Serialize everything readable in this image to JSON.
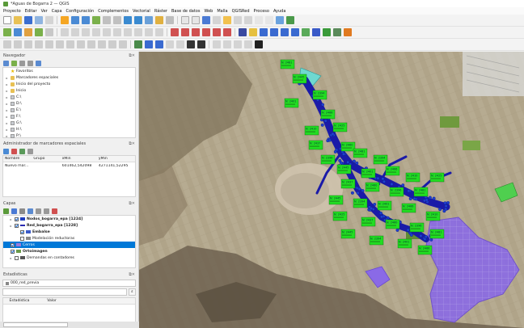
{
  "window": {
    "title": "*Aguas de Bogarra 2 — QGIS"
  },
  "menu": [
    "Proyecto",
    "Editar",
    "Ver",
    "Capa",
    "Configuración",
    "Complementos",
    "Vectorial",
    "Ráster",
    "Base de datos",
    "Web",
    "Malla",
    "QGISRed",
    "Proceso",
    "Ayuda"
  ],
  "browser": {
    "title": "Navegador",
    "items": [
      {
        "label": "Favoritos",
        "icon": "star-icon"
      },
      {
        "label": "Marcadores espaciales",
        "icon": "bookmark-icon"
      },
      {
        "label": "Inicio del proyecto",
        "icon": "folder-icon"
      },
      {
        "label": "Inicio",
        "icon": "folder-icon"
      },
      {
        "label": "C:\\",
        "icon": "drive-icon"
      },
      {
        "label": "D:\\",
        "icon": "drive-icon"
      },
      {
        "label": "E:\\",
        "icon": "drive-icon"
      },
      {
        "label": "F:\\",
        "icon": "drive-icon"
      },
      {
        "label": "G:\\",
        "icon": "drive-icon"
      },
      {
        "label": "H:\\",
        "icon": "drive-icon"
      },
      {
        "label": "P:\\",
        "icon": "drive-icon"
      }
    ]
  },
  "bookmarks": {
    "title": "Administrador de marcadores espaciales",
    "columns": [
      "Nombre",
      "Grupo",
      "xMin",
      "yMin"
    ],
    "rows": [
      {
        "name": "Nuevo mar...",
        "group": "",
        "xmin": "601462,542098",
        "ymin": "4271141,52295"
      }
    ]
  },
  "layers": {
    "title": "Capas",
    "items": [
      {
        "label": "Nodos_bogarra_epa [1224]",
        "checked": true,
        "bold": true,
        "indent": 1,
        "swatch": "#1f3fbf"
      },
      {
        "label": "Red_bogarra_epa [1228]",
        "checked": true,
        "bold": true,
        "indent": 1,
        "swatch": "#2a2ab0"
      },
      {
        "label": "Embalse",
        "checked": true,
        "bold": true,
        "indent": 2,
        "swatch": "#3a5ac8"
      },
      {
        "label": "Modelación reductoras",
        "checked": false,
        "bold": false,
        "indent": 2,
        "swatch": "#8a8a8a"
      },
      {
        "label": "Cerros",
        "checked": true,
        "bold": false,
        "indent": 0,
        "swatch": "#9a7ad8",
        "selected": true
      },
      {
        "label": "Ortoimagen",
        "checked": true,
        "bold": true,
        "indent": 0,
        "swatch": "#6a9a4a"
      },
      {
        "label": "Demandas en contadores",
        "checked": false,
        "bold": false,
        "indent": 1,
        "swatch": "#555555"
      }
    ]
  },
  "statistics": {
    "title": "Estadísticas",
    "layer": "000_red_previa",
    "columns": [
      "Estadística",
      "Valor"
    ]
  },
  "map": {
    "label_texts": [
      "N: 2481",
      "N: 2445",
      "N: 2394",
      "N: 2401",
      "N: 2466",
      "N: 2410",
      "N: 2425",
      "N: 2437",
      "N: 2460",
      "N: 2396"
    ]
  },
  "colors": {
    "accent": "#0078d7",
    "node_fill": "#22dd22",
    "pipe": "#1a1aa8",
    "polygon": "#8a6ae6"
  }
}
